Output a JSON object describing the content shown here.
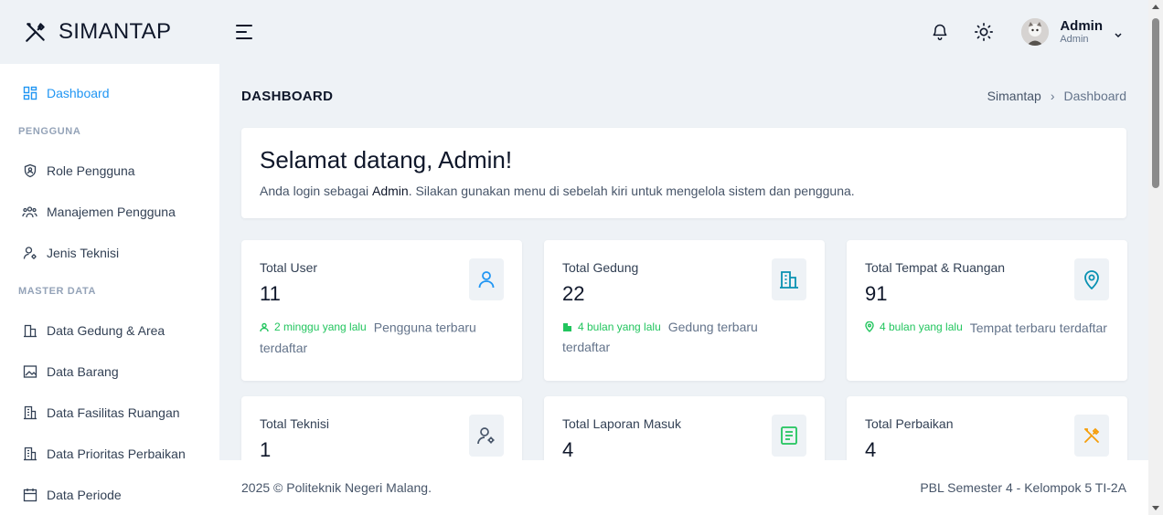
{
  "brand": {
    "name": "SIMANTAP"
  },
  "header": {
    "icons": [
      "bell-icon",
      "sun-icon"
    ],
    "user": {
      "name": "Admin",
      "role": "Admin"
    }
  },
  "sidebar": {
    "dashboard": "Dashboard",
    "section_pengguna": "PENGGUNA",
    "role_pengguna": "Role Pengguna",
    "manajemen_pengguna": "Manajemen Pengguna",
    "jenis_teknisi": "Jenis Teknisi",
    "section_master": "MASTER DATA",
    "data_gedung": "Data Gedung & Area",
    "data_barang": "Data Barang",
    "data_fasilitas": "Data Fasilitas Ruangan",
    "data_prioritas": "Data Prioritas Perbaikan",
    "data_periode": "Data Periode"
  },
  "page": {
    "title": "DASHBOARD",
    "breadcrumb": {
      "root": "Simantap",
      "sep": "›",
      "current": "Dashboard"
    }
  },
  "welcome": {
    "heading": "Selamat datang, Admin!",
    "text_before": "Anda login sebagai ",
    "text_bold": "Admin",
    "text_after": ". Silakan gunakan menu di sebelah kiri untuk mengelola sistem dan pengguna."
  },
  "cards": {
    "user": {
      "label": "Total User",
      "value": "11",
      "meta": "2 minggu yang lalu",
      "desc": "Pengguna terbaru terdaftar",
      "icon": "user-icon"
    },
    "gedung": {
      "label": "Total Gedung",
      "value": "22",
      "meta": "4 bulan yang lalu",
      "desc": "Gedung terbaru terdaftar",
      "icon": "building-icon"
    },
    "tempat": {
      "label": "Total Tempat & Ruangan",
      "value": "91",
      "meta": "4 bulan yang lalu",
      "desc": "Tempat terbaru terdaftar",
      "icon": "map-pin-icon"
    },
    "teknisi": {
      "label": "Total Teknisi",
      "value": "1",
      "icon": "user-cog-icon"
    },
    "laporan": {
      "label": "Total Laporan Masuk",
      "value": "4",
      "icon": "report-icon"
    },
    "perbaikan": {
      "label": "Total Perbaikan",
      "value": "4",
      "icon": "tools-icon"
    }
  },
  "footer": {
    "left": "2025 © Politeknik Negeri Malang.",
    "right": "PBL Semester 4 - Kelompok 5 TI-2A"
  },
  "colors": {
    "accent": "#2196f3",
    "success": "#22c55e",
    "teal": "#0891b2",
    "warning": "#f59e0b"
  }
}
